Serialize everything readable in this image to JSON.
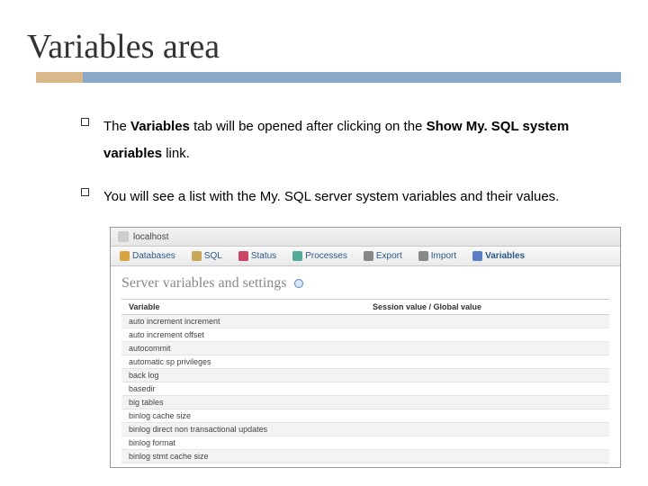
{
  "slide": {
    "title": "Variables area",
    "bullets": [
      {
        "pre": "The ",
        "b1": "Variables",
        "mid": " tab will be opened after clicking on the ",
        "b2": "Show My. SQL system variables",
        "post": " link."
      },
      {
        "text": "You will see a list with the My. SQL server system variables and their values."
      }
    ]
  },
  "crumb": {
    "host": "localhost"
  },
  "tabs": {
    "databases": "Databases",
    "sql": "SQL",
    "status": "Status",
    "processes": "Processes",
    "export": "Export",
    "import": "Import",
    "variables": "Variables"
  },
  "panel": {
    "title": "Server variables and settings"
  },
  "table": {
    "head_variable": "Variable",
    "head_value": "Session value / Global value",
    "rows": [
      "auto increment increment",
      "auto increment offset",
      "autocommit",
      "automatic sp privileges",
      "back log",
      "basedir",
      "big tables",
      "binlog cache size",
      "binlog direct non transactional updates",
      "binlog format",
      "binlog stmt cache size"
    ]
  }
}
